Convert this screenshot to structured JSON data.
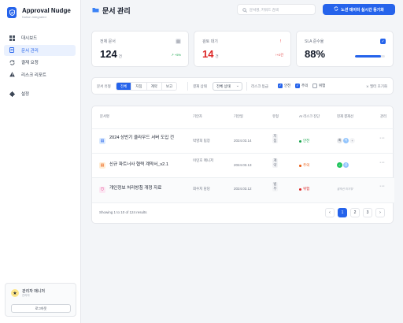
{
  "app": {
    "title": "Approval Nudge",
    "subtitle": "Notion Integrated"
  },
  "sidebar": {
    "items": [
      {
        "label": "대시보드",
        "icon": "grid-icon"
      },
      {
        "label": "문서 관리",
        "icon": "document-icon",
        "active": true
      },
      {
        "label": "결재 요청",
        "icon": "sync-icon"
      },
      {
        "label": "리스크 리포트",
        "icon": "warning-icon"
      },
      {
        "label": "설정",
        "icon": "gear-icon"
      }
    ]
  },
  "user": {
    "name": "관리자 매니저",
    "role": "관리자",
    "logout": "로그아웃"
  },
  "header": {
    "title": "문서 관리",
    "search_placeholder": "문서명, 키워드 검색",
    "sync_button": "노션 데이터 실시간 동기화"
  },
  "stats": [
    {
      "label": "전체 문서",
      "value": "124",
      "unit": "건",
      "delta": "+5%",
      "color": "#9ca3af"
    },
    {
      "label": "검토 대기",
      "value": "14",
      "unit": "건",
      "delta": "+2건",
      "color": "#ef4444"
    },
    {
      "label": "SLA 준수율",
      "value": "88%",
      "unit": "",
      "progress": 0.88,
      "color": "#2563eb"
    }
  ],
  "filters": {
    "doc_type_label": "문서 유형",
    "doc_types": [
      "전체",
      "지침",
      "계약",
      "보고"
    ],
    "doc_type_selected": "전체",
    "status_label": "결재 상태",
    "status_value": "전체 상태",
    "risk_label": "리스크 등급",
    "risk_levels": [
      {
        "label": "안전",
        "checked": true
      },
      {
        "label": "주의",
        "checked": true
      },
      {
        "label": "위험",
        "checked": false
      }
    ],
    "reset": "필터 초기화"
  },
  "table": {
    "headers": [
      "문서명",
      "기안자",
      "기안일",
      "유형",
      "AI 리스크 진단",
      "현재 결재선",
      "관리"
    ],
    "rows": [
      {
        "title": "2024 상반기 클라우드 서버 도입 건",
        "icon": "document-icon",
        "icon_color": "#2563eb",
        "author": "박영희 팀장",
        "date": "2024.03.14",
        "type": "지침",
        "risk": "안전",
        "risk_color": "#16a34a",
        "approvers": [
          "최",
          "박",
          "+"
        ]
      },
      {
        "title": "신규 파트너사 협력 계약서_v2.1",
        "icon": "contract-icon",
        "icon_color": "#ea580c",
        "author": "이민호 매니저",
        "date": "2024.03.13",
        "type": "계약",
        "risk": "주의",
        "risk_color": "#ea580c",
        "approvers": [
          "✓",
          "김"
        ]
      },
      {
        "title": "개인정보 처리방침 개정 자료",
        "icon": "shield-icon",
        "icon_color": "#db2777",
        "author": "최수지 담당",
        "date": "2024.03.12",
        "type": "법무",
        "risk": "위험",
        "risk_color": "#dc2626",
        "approvers_text": "결재선 미지정"
      }
    ]
  },
  "pagination": {
    "info": "Showing 1 to 10 of 124 results",
    "pages": [
      "1",
      "2",
      "3"
    ],
    "current": "1"
  }
}
